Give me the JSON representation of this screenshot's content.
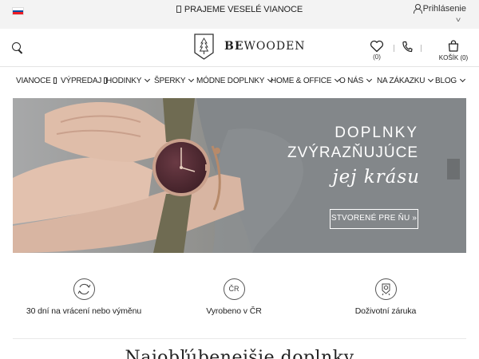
{
  "topbar": {
    "announcement": "PRAJEME VESELÉ VIANOCE",
    "login_label": "Prihlásenie",
    "flag_colors": [
      "#ffffff",
      "#0b4ea2",
      "#ee1c25"
    ]
  },
  "header": {
    "logo_bold": "BE",
    "logo_rest": "WOODEN",
    "wishlist_count": "(0)",
    "cart_label": "KOŠÍK (0)",
    "icons": [
      "search-icon",
      "logo-tree-icon",
      "heart-icon",
      "phone-icon",
      "cart-icon"
    ]
  },
  "nav": {
    "items": [
      {
        "label": "VIANOCE",
        "marker": "box"
      },
      {
        "label": "VÝPREDAJ",
        "marker": "box"
      },
      {
        "label": "HODINKY",
        "marker": "chevron"
      },
      {
        "label": "ŠPERKY",
        "marker": "chevron"
      },
      {
        "label": "MÓDNE DOPLNKY",
        "marker": "chevron"
      },
      {
        "label": "HOME & OFFICE",
        "marker": "chevron"
      },
      {
        "label": "O NÁS",
        "marker": "chevron"
      },
      {
        "label": "NA ZÁKAZKU",
        "marker": "chevron"
      },
      {
        "label": "BLOG",
        "marker": "chevron"
      }
    ]
  },
  "hero": {
    "line1": "DOPLNKY",
    "line2": "ZVÝRAZŇUJÚCE",
    "line3": "jej krásu",
    "button_label": "STVORENÉ PRE ŇU »"
  },
  "features": [
    {
      "text": "30 dní na vrácení nebo výměnu",
      "icon": "exchange-icon"
    },
    {
      "text": "Vyrobeno v ČR",
      "icon": "cr-badge-icon",
      "icon_text": "ČR"
    },
    {
      "text": "Doživotní záruka",
      "icon": "warranty-icon"
    }
  ],
  "section": {
    "title": "Najobľúbenejšie doplnky"
  },
  "colors": {
    "topbar_bg": "#f3f3f3",
    "text": "#222222",
    "hero_text": "#ffffff"
  }
}
